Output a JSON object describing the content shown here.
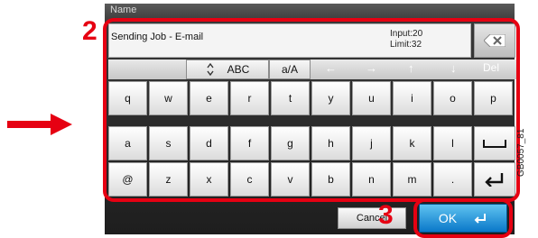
{
  "screen": {
    "title": "Name"
  },
  "callouts": {
    "step_2": "2",
    "step_3": "3"
  },
  "input": {
    "value": "Sending Job - E-mail",
    "input_count": "Input:20",
    "limit": "Limit:32"
  },
  "controls": {
    "abc": "ABC",
    "a_over_a": "a/A",
    "del": "Del"
  },
  "keyboard": {
    "row1": [
      "q",
      "w",
      "e",
      "r",
      "t",
      "y",
      "u",
      "i",
      "o",
      "p"
    ],
    "row2": [
      "a",
      "s",
      "d",
      "f",
      "g",
      "h",
      "j",
      "k",
      "l"
    ],
    "row3": [
      "@",
      "z",
      "x",
      "c",
      "v",
      "b",
      "n",
      "m",
      "."
    ]
  },
  "buttons": {
    "cancel": "Cancel",
    "ok": "OK"
  },
  "figure_code": "GB0057_81",
  "colors": {
    "callout": "#e60012",
    "ok_blue": "#0a78c9"
  }
}
